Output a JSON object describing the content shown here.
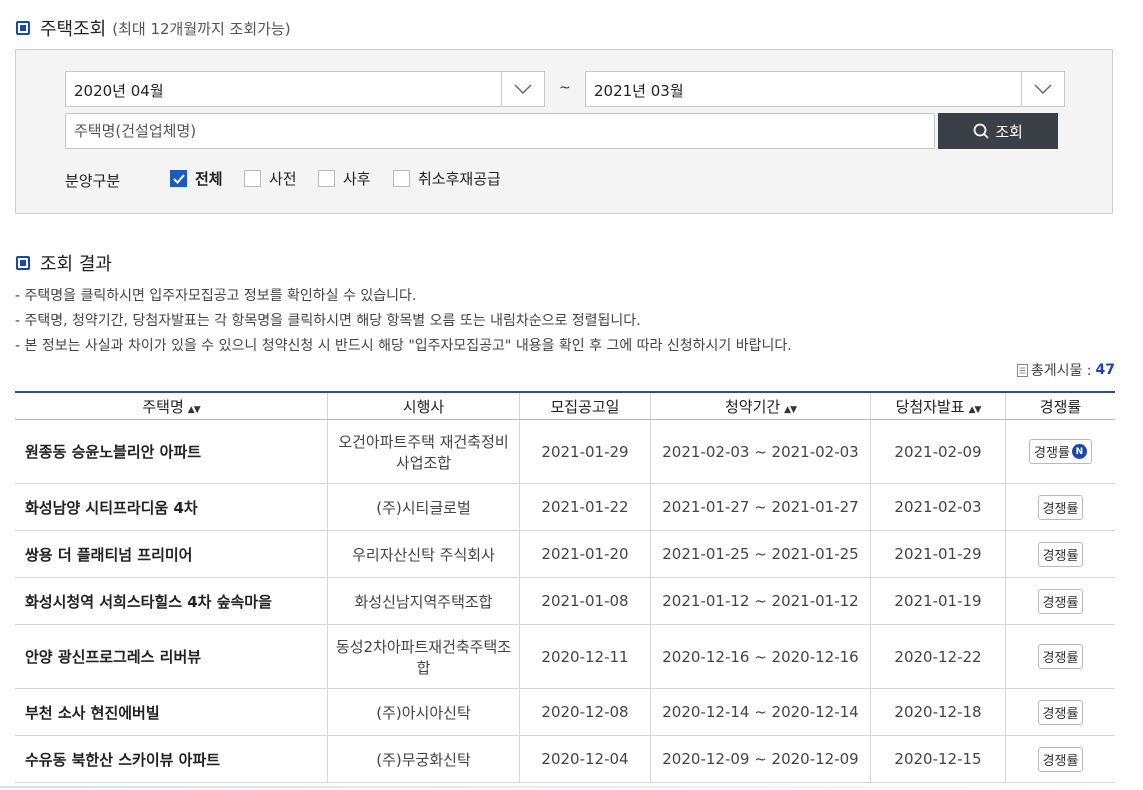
{
  "section1": {
    "title": "주택조회",
    "subtitle": "(최대 12개월까지 조회가능)"
  },
  "search": {
    "start_month": "2020년 04월",
    "tilde": "~",
    "end_month": "2021년 03월",
    "name_placeholder": "주택명(건설업체명)",
    "search_button": "조회",
    "filter_label": "분양구분",
    "filters": [
      {
        "label": "전체",
        "checked": true
      },
      {
        "label": "사전",
        "checked": false
      },
      {
        "label": "사후",
        "checked": false
      },
      {
        "label": "취소후재공급",
        "checked": false
      }
    ]
  },
  "section2": {
    "title": "조회 결과"
  },
  "notes": [
    "-  주택명을 클릭하시면 입주자모집공고 정보를 확인하실 수 있습니다.",
    "-  주택명, 청약기간, 당첨자발표는 각 항목명을 클릭하시면 해당 항목별 오름 또는 내림차순으로 정렬됩니다.",
    "-  본 정보는 사실과 차이가 있을 수 있으니 청약신청 시 반드시 해당 \"입주자모집공고\" 내용을 확인 후 그에 따라 신청하시기 바랍니다."
  ],
  "total": {
    "label": "총게시물 :",
    "count": "47"
  },
  "table": {
    "headers": [
      "주택명",
      "시행사",
      "모집공고일",
      "청약기간",
      "당첨자발표",
      "경쟁률"
    ],
    "sort_mark": "▲▼",
    "rate_label": "경쟁률",
    "new_badge": "N",
    "rows": [
      {
        "name": "원종동 승윤노블리안 아파트",
        "builder": "오건아파트주택 재건축정비사업조합",
        "notice": "2021-01-29",
        "period": "2021-02-03 ~ 2021-02-03",
        "announce": "2021-02-09",
        "new": true
      },
      {
        "name": "화성남양 시티프라디움 4차",
        "builder": "(주)시티글로벌",
        "notice": "2021-01-22",
        "period": "2021-01-27 ~ 2021-01-27",
        "announce": "2021-02-03",
        "new": false
      },
      {
        "name": "쌍용 더 플래티넘 프리미어",
        "builder": "우리자산신탁 주식회사",
        "notice": "2021-01-20",
        "period": "2021-01-25 ~ 2021-01-25",
        "announce": "2021-01-29",
        "new": false
      },
      {
        "name": "화성시청역 서희스타힐스 4차 숲속마을",
        "builder": "화성신남지역주택조합",
        "notice": "2021-01-08",
        "period": "2021-01-12 ~ 2021-01-12",
        "announce": "2021-01-19",
        "new": false
      },
      {
        "name": "안양 광신프로그레스 리버뷰",
        "builder": "동성2차아파트재건축주택조합",
        "notice": "2020-12-11",
        "period": "2020-12-16 ~ 2020-12-16",
        "announce": "2020-12-22",
        "new": false
      },
      {
        "name": "부천 소사 현진에버빌",
        "builder": "(주)아시아신탁",
        "notice": "2020-12-08",
        "period": "2020-12-14 ~ 2020-12-14",
        "announce": "2020-12-18",
        "new": false
      },
      {
        "name": "수유동 북한산 스카이뷰 아파트",
        "builder": "(주)무궁화신탁",
        "notice": "2020-12-04",
        "period": "2020-12-09 ~ 2020-12-09",
        "announce": "2020-12-15",
        "new": false
      }
    ]
  }
}
